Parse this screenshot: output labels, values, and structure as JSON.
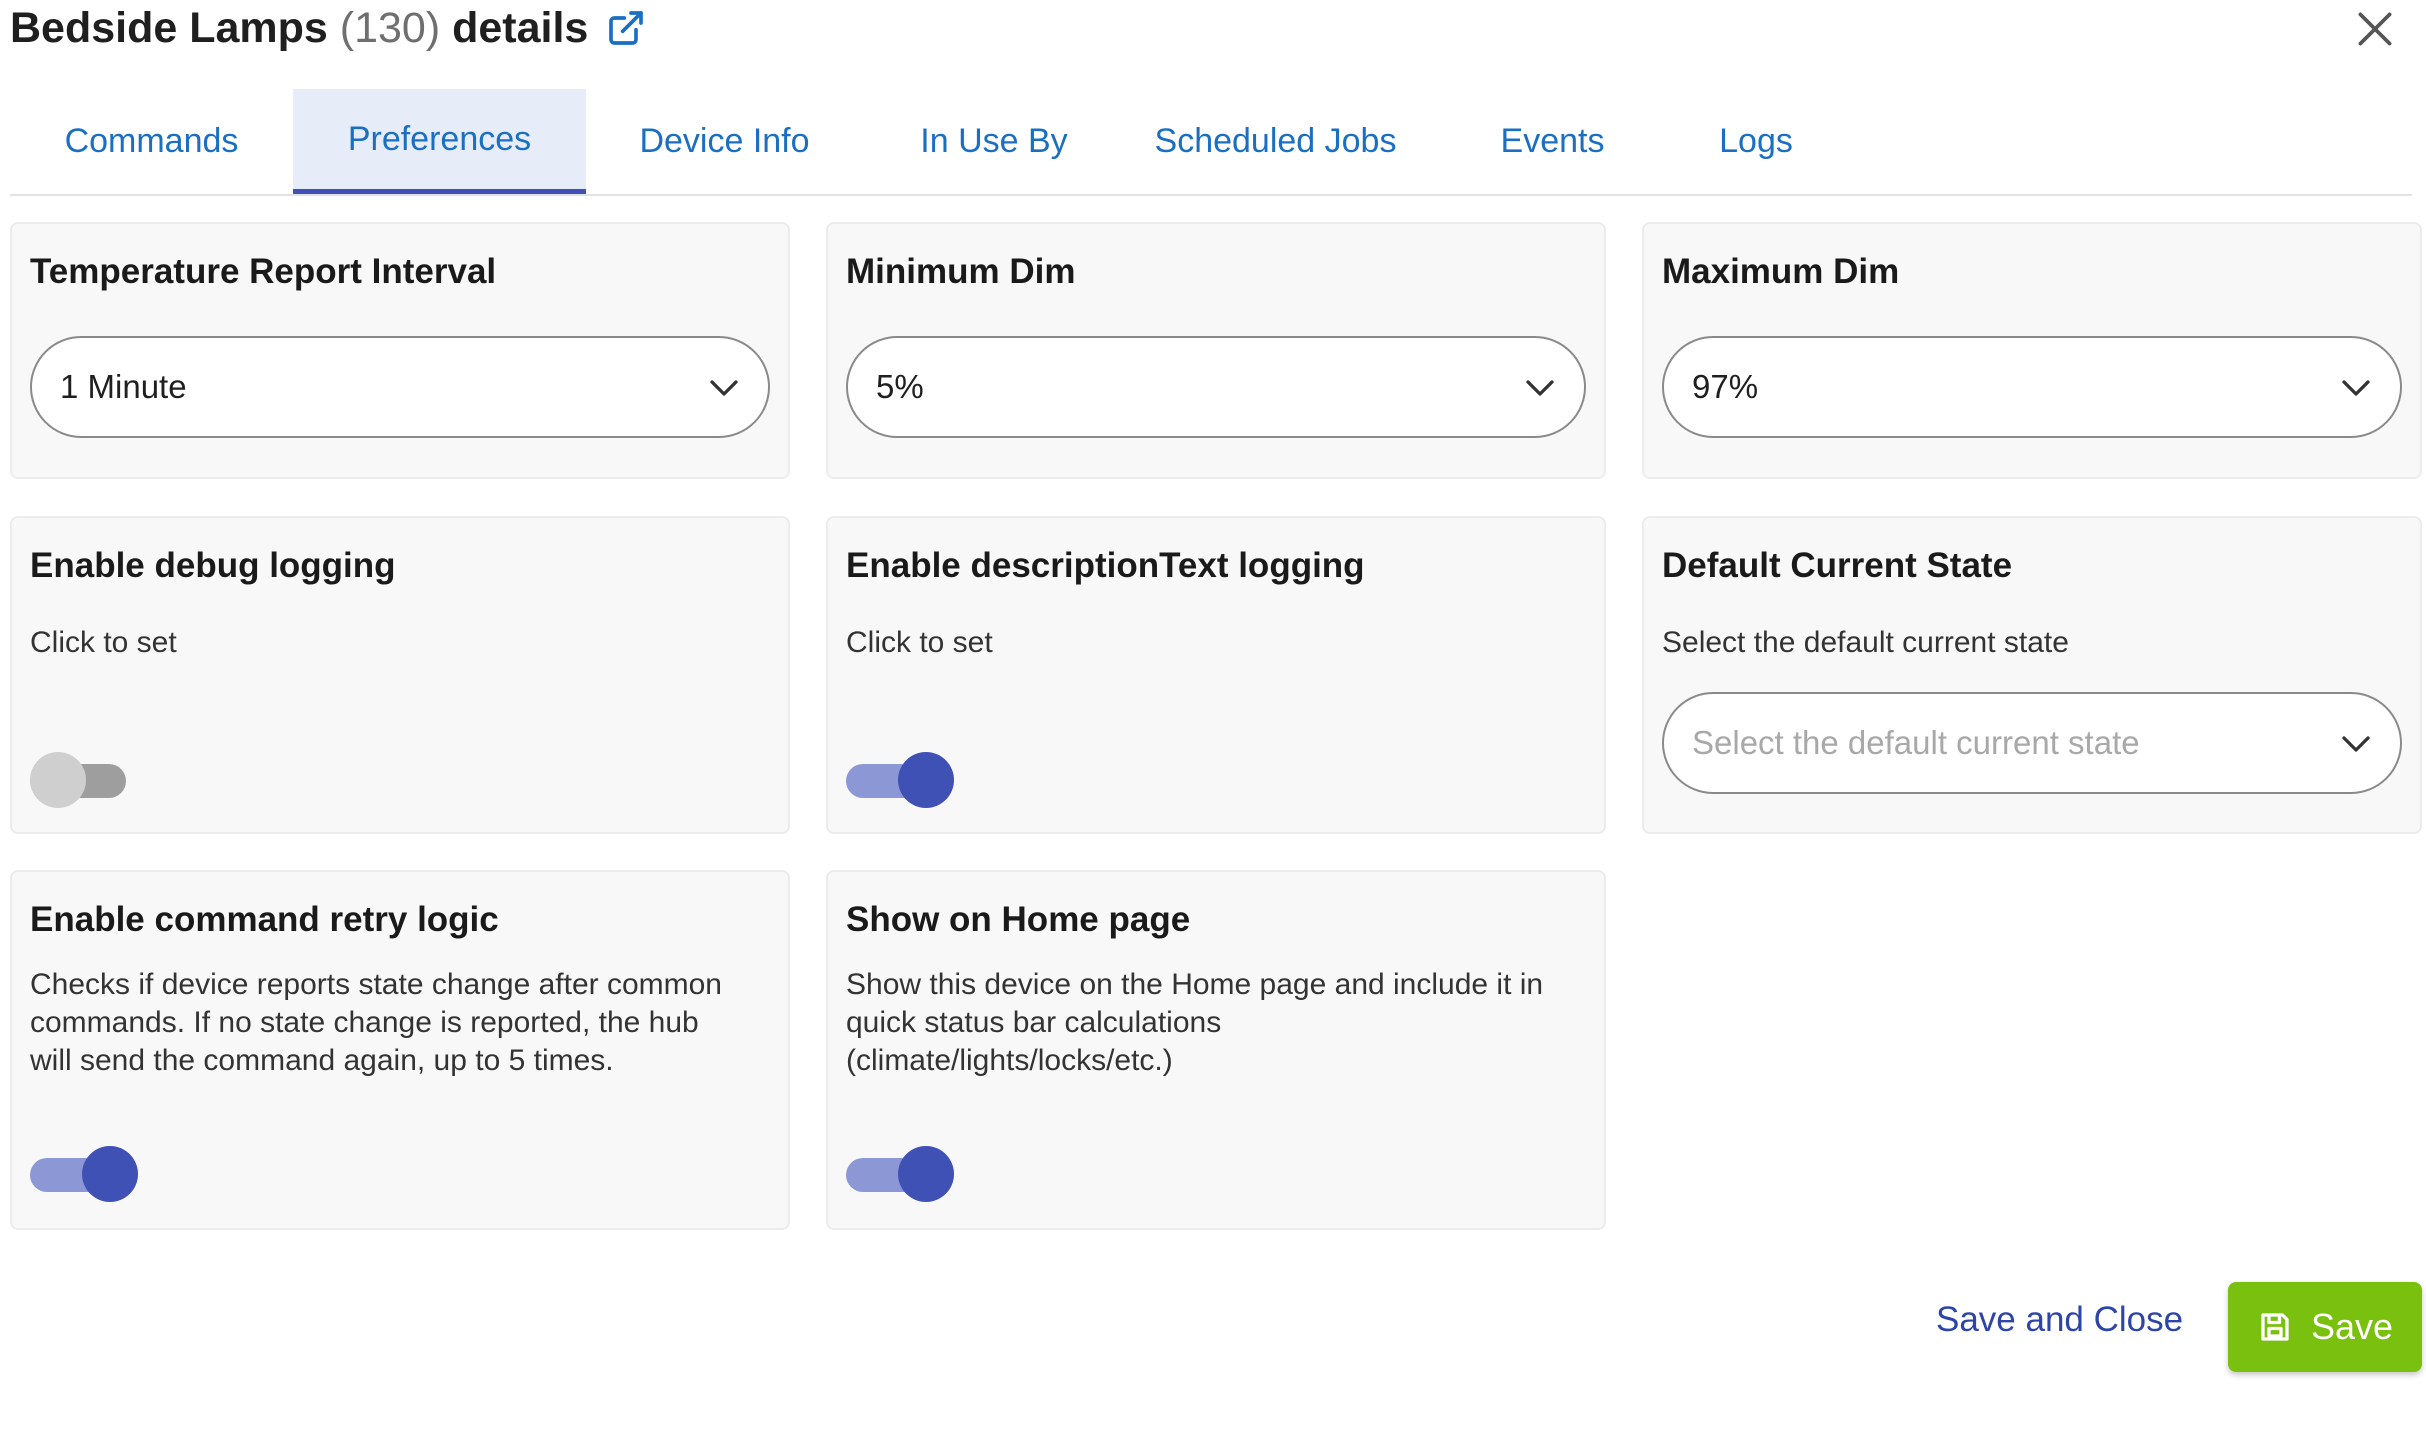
{
  "header": {
    "title_name": "Bedside Lamps",
    "title_count": "(130)",
    "title_suffix": "details"
  },
  "tabs": [
    {
      "label": "Commands",
      "active": false
    },
    {
      "label": "Preferences",
      "active": true
    },
    {
      "label": "Device Info",
      "active": false
    },
    {
      "label": "In Use By",
      "active": false
    },
    {
      "label": "Scheduled Jobs",
      "active": false
    },
    {
      "label": "Events",
      "active": false
    },
    {
      "label": "Logs",
      "active": false
    }
  ],
  "preferences": {
    "temperature_report_interval": {
      "title": "Temperature Report Interval",
      "value": "1 Minute"
    },
    "minimum_dim": {
      "title": "Minimum Dim",
      "value": "5%"
    },
    "maximum_dim": {
      "title": "Maximum Dim",
      "value": "97%"
    },
    "debug_logging": {
      "title": "Enable debug logging",
      "description": "Click to set",
      "enabled": false
    },
    "description_text_logging": {
      "title": "Enable descriptionText logging",
      "description": "Click to set",
      "enabled": true
    },
    "default_current_state": {
      "title": "Default Current State",
      "description": "Select the default current state",
      "placeholder": "Select the default current state"
    },
    "command_retry": {
      "title": "Enable command retry logic",
      "description": "Checks if device reports state change after common commands. If no state change is reported, the hub will send the command again, up to 5 times.",
      "enabled": true
    },
    "show_on_home": {
      "title": "Show on Home page",
      "description": "Show this device on the Home page and include it in quick status bar calculations (climate/lights/locks/etc.)",
      "enabled": true
    }
  },
  "footer": {
    "save_and_close_label": "Save and Close",
    "save_label": "Save"
  },
  "colors": {
    "accent": "#3f51b5",
    "tab_text": "#1a6fc2",
    "save_button": "#7ac00f"
  }
}
